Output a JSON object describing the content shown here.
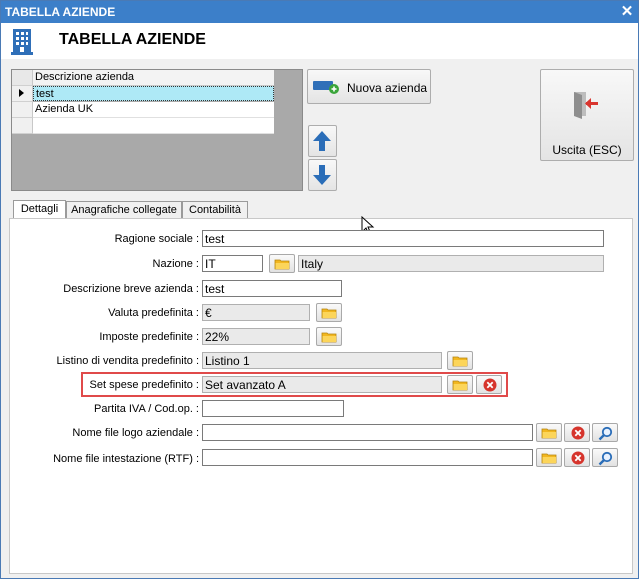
{
  "window": {
    "title": "TABELLA AZIENDE",
    "header_title": "TABELLA AZIENDE"
  },
  "grid": {
    "column_header": "Descrizione azienda",
    "rows": [
      "test",
      "Azienda UK",
      ""
    ]
  },
  "buttons": {
    "nuova_azienda": "Nuova azienda",
    "uscita": "Uscita (ESC)"
  },
  "tabs": [
    "Dettagli",
    "Anagrafiche collegate",
    "Contabilità"
  ],
  "form": {
    "ragione_sociale": {
      "label": "Ragione sociale :",
      "value": "test"
    },
    "nazione": {
      "label": "Nazione :",
      "code": "IT",
      "name": "Italy"
    },
    "descrizione_breve": {
      "label": "Descrizione breve azienda :",
      "value": "test"
    },
    "valuta": {
      "label": "Valuta predefinita :",
      "value": "€"
    },
    "imposte": {
      "label": "Imposte predefinite :",
      "value": "22%"
    },
    "listino": {
      "label": "Listino di vendita predefinito :",
      "value": "Listino 1"
    },
    "set_spese": {
      "label": "Set spese predefinito :",
      "value": "Set avanzato A"
    },
    "partita_iva": {
      "label": "Partita IVA / Cod.op. :",
      "value": ""
    },
    "logo": {
      "label": "Nome file logo aziendale :",
      "value": ""
    },
    "intestazione": {
      "label": "Nome file intestazione (RTF) :",
      "value": ""
    }
  },
  "colors": {
    "titlebar": "#3c7fc9",
    "selection": "#aee9f6",
    "highlight": "#e04a4a",
    "arrow": "#2a6db8"
  }
}
